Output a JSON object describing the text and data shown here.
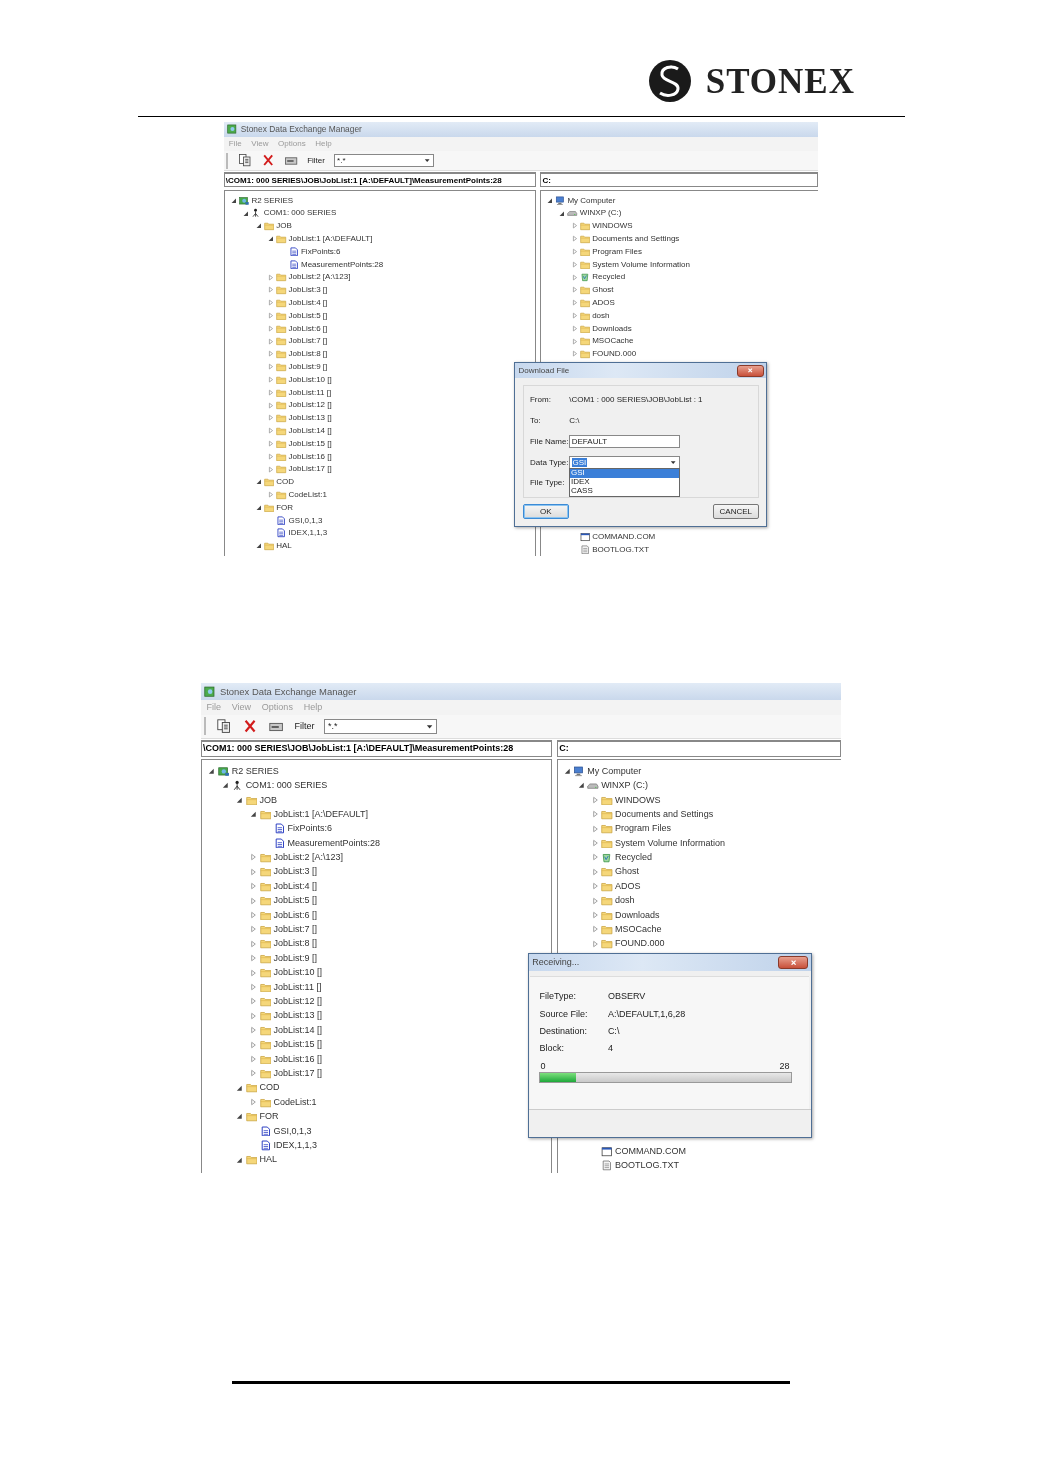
{
  "page": {
    "brand": "STONEX"
  },
  "screenshots": [
    {
      "title": "Stonex Data Exchange Manager",
      "menu": [
        {
          "label": "File"
        },
        {
          "label": "View"
        },
        {
          "label": "Options"
        },
        {
          "label": "Help"
        }
      ],
      "filter_label": "Filter",
      "filter_value": "*.*",
      "path_left": "\\COM1: 000 SERIES\\JOB\\JobList:1 [A:\\DEFAULT]\\MeasurementPoints:28",
      "path_right": "C:",
      "left_tree": [
        {
          "label": "R2 SERIES",
          "kind": "series",
          "expanded": true,
          "children": [
            {
              "label": "COM1: 000 SERIES",
              "kind": "instrument",
              "expanded": true,
              "children": [
                {
                  "label": "JOB",
                  "kind": "folder",
                  "expanded": true,
                  "children": [
                    {
                      "label": "JobList:1 [A:\\DEFAULT]",
                      "kind": "folder",
                      "expanded": true,
                      "children": [
                        {
                          "label": "FixPoints:6",
                          "kind": "doc"
                        },
                        {
                          "label": "MeasurementPoints:28",
                          "kind": "doc"
                        }
                      ]
                    },
                    {
                      "label": "JobList:2 [A:\\123]",
                      "kind": "folder",
                      "expanded": false
                    },
                    {
                      "label": "JobList:3 []",
                      "kind": "folder",
                      "expanded": false
                    },
                    {
                      "label": "JobList:4 []",
                      "kind": "folder",
                      "expanded": false
                    },
                    {
                      "label": "JobList:5 []",
                      "kind": "folder",
                      "expanded": false
                    },
                    {
                      "label": "JobList:6 []",
                      "kind": "folder",
                      "expanded": false
                    },
                    {
                      "label": "JobList:7 []",
                      "kind": "folder",
                      "expanded": false
                    },
                    {
                      "label": "JobList:8 []",
                      "kind": "folder",
                      "expanded": false
                    },
                    {
                      "label": "JobList:9 []",
                      "kind": "folder",
                      "expanded": false
                    },
                    {
                      "label": "JobList:10 []",
                      "kind": "folder",
                      "expanded": false
                    },
                    {
                      "label": "JobList:11 []",
                      "kind": "folder",
                      "expanded": false
                    },
                    {
                      "label": "JobList:12 []",
                      "kind": "folder",
                      "expanded": false
                    },
                    {
                      "label": "JobList:13 []",
                      "kind": "folder",
                      "expanded": false
                    },
                    {
                      "label": "JobList:14 []",
                      "kind": "folder",
                      "expanded": false
                    },
                    {
                      "label": "JobList:15 []",
                      "kind": "folder",
                      "expanded": false
                    },
                    {
                      "label": "JobList:16 []",
                      "kind": "folder",
                      "expanded": false
                    },
                    {
                      "label": "JobList:17 []",
                      "kind": "folder",
                      "expanded": false
                    }
                  ]
                },
                {
                  "label": "COD",
                  "kind": "folder",
                  "expanded": true,
                  "children": [
                    {
                      "label": "CodeList:1",
                      "kind": "folder",
                      "expanded": false
                    }
                  ]
                },
                {
                  "label": "FOR",
                  "kind": "folder",
                  "expanded": true,
                  "children": [
                    {
                      "label": "GSI,0,1,3",
                      "kind": "doc"
                    },
                    {
                      "label": "IDEX,1,1,3",
                      "kind": "doc"
                    }
                  ]
                },
                {
                  "label": "HAL",
                  "kind": "folder",
                  "expanded": true
                }
              ]
            }
          ]
        }
      ],
      "right_tree": [
        {
          "label": "My Computer",
          "kind": "computer",
          "expanded": true,
          "children": [
            {
              "label": "WINXP (C:)",
              "kind": "drive",
              "expanded": true,
              "children": [
                {
                  "label": "WINDOWS",
                  "kind": "folder",
                  "expanded": false
                },
                {
                  "label": "Documents and Settings",
                  "kind": "folder",
                  "expanded": false
                },
                {
                  "label": "Program Files",
                  "kind": "folder",
                  "expanded": false
                },
                {
                  "label": "System Volume Information",
                  "kind": "folder",
                  "expanded": false
                },
                {
                  "label": "Recycled",
                  "kind": "recycle",
                  "expanded": false
                },
                {
                  "label": "Ghost",
                  "kind": "folder",
                  "expanded": false
                },
                {
                  "label": "ADOS",
                  "kind": "folder",
                  "expanded": false
                },
                {
                  "label": "dosh",
                  "kind": "folder",
                  "expanded": false
                },
                {
                  "label": "Downloads",
                  "kind": "folder",
                  "expanded": false
                },
                {
                  "label": "MSOCache",
                  "kind": "folder",
                  "expanded": false
                },
                {
                  "label": "FOUND.000",
                  "kind": "folder",
                  "expanded": false
                },
                {
                  "label": "COMMAND.COM",
                  "kind": "exe"
                },
                {
                  "label": "BOOTLOG.TXT",
                  "kind": "txt"
                }
              ]
            }
          ]
        }
      ],
      "dialog": {
        "kind": "download",
        "title": "Download File",
        "fields": [
          {
            "label": "From:",
            "kind": "text",
            "value": "\\COM1 : 000 SERIES\\JOB\\JobList : 1"
          },
          {
            "label": "To:",
            "kind": "text",
            "value": "C:\\"
          },
          {
            "label": "File Name:",
            "kind": "input",
            "value": "DEFAULT"
          },
          {
            "label": "Data Type:",
            "kind": "select",
            "value": "GSI",
            "options": [
              {
                "label": "GSI",
                "selected": true
              },
              {
                "label": "IDEX",
                "selected": false
              },
              {
                "label": "CASS",
                "selected": false
              }
            ]
          },
          {
            "label": "File Type:",
            "kind": "text"
          }
        ],
        "buttons": [
          {
            "label": "OK",
            "focused": true
          },
          {
            "label": "CANCEL",
            "focused": false
          }
        ]
      }
    },
    {
      "title": "Stonex Data Exchange Manager",
      "menu": [
        {
          "label": "File"
        },
        {
          "label": "View"
        },
        {
          "label": "Options"
        },
        {
          "label": "Help"
        }
      ],
      "filter_label": "Filter",
      "filter_value": "*.*",
      "path_left": "\\COM1: 000 SERIES\\JOB\\JobList:1 [A:\\DEFAULT]\\MeasurementPoints:28",
      "path_right": "C:",
      "left_tree": [
        {
          "label": "R2 SERIES",
          "kind": "series",
          "expanded": true,
          "children": [
            {
              "label": "COM1: 000 SERIES",
              "kind": "instrument",
              "expanded": true,
              "children": [
                {
                  "label": "JOB",
                  "kind": "folder",
                  "expanded": true,
                  "children": [
                    {
                      "label": "JobList:1 [A:\\DEFAULT]",
                      "kind": "folder",
                      "expanded": true,
                      "children": [
                        {
                          "label": "FixPoints:6",
                          "kind": "doc"
                        },
                        {
                          "label": "MeasurementPoints:28",
                          "kind": "doc"
                        }
                      ]
                    },
                    {
                      "label": "JobList:2 [A:\\123]",
                      "kind": "folder",
                      "expanded": false
                    },
                    {
                      "label": "JobList:3 []",
                      "kind": "folder",
                      "expanded": false
                    },
                    {
                      "label": "JobList:4 []",
                      "kind": "folder",
                      "expanded": false
                    },
                    {
                      "label": "JobList:5 []",
                      "kind": "folder",
                      "expanded": false
                    },
                    {
                      "label": "JobList:6 []",
                      "kind": "folder",
                      "expanded": false
                    },
                    {
                      "label": "JobList:7 []",
                      "kind": "folder",
                      "expanded": false
                    },
                    {
                      "label": "JobList:8 []",
                      "kind": "folder",
                      "expanded": false
                    },
                    {
                      "label": "JobList:9 []",
                      "kind": "folder",
                      "expanded": false
                    },
                    {
                      "label": "JobList:10 []",
                      "kind": "folder",
                      "expanded": false
                    },
                    {
                      "label": "JobList:11 []",
                      "kind": "folder",
                      "expanded": false
                    },
                    {
                      "label": "JobList:12 []",
                      "kind": "folder",
                      "expanded": false
                    },
                    {
                      "label": "JobList:13 []",
                      "kind": "folder",
                      "expanded": false
                    },
                    {
                      "label": "JobList:14 []",
                      "kind": "folder",
                      "expanded": false
                    },
                    {
                      "label": "JobList:15 []",
                      "kind": "folder",
                      "expanded": false
                    },
                    {
                      "label": "JobList:16 []",
                      "kind": "folder",
                      "expanded": false
                    },
                    {
                      "label": "JobList:17 []",
                      "kind": "folder",
                      "expanded": false
                    }
                  ]
                },
                {
                  "label": "COD",
                  "kind": "folder",
                  "expanded": true,
                  "children": [
                    {
                      "label": "CodeList:1",
                      "kind": "folder",
                      "expanded": false
                    }
                  ]
                },
                {
                  "label": "FOR",
                  "kind": "folder",
                  "expanded": true,
                  "children": [
                    {
                      "label": "GSI,0,1,3",
                      "kind": "doc"
                    },
                    {
                      "label": "IDEX,1,1,3",
                      "kind": "doc"
                    }
                  ]
                },
                {
                  "label": "HAL",
                  "kind": "folder",
                  "expanded": true
                }
              ]
            }
          ]
        }
      ],
      "right_tree": [
        {
          "label": "My Computer",
          "kind": "computer",
          "expanded": true,
          "children": [
            {
              "label": "WINXP (C:)",
              "kind": "drive",
              "expanded": true,
              "children": [
                {
                  "label": "WINDOWS",
                  "kind": "folder",
                  "expanded": false
                },
                {
                  "label": "Documents and Settings",
                  "kind": "folder",
                  "expanded": false
                },
                {
                  "label": "Program Files",
                  "kind": "folder",
                  "expanded": false
                },
                {
                  "label": "System Volume Information",
                  "kind": "folder",
                  "expanded": false
                },
                {
                  "label": "Recycled",
                  "kind": "recycle",
                  "expanded": false
                },
                {
                  "label": "Ghost",
                  "kind": "folder",
                  "expanded": false
                },
                {
                  "label": "ADOS",
                  "kind": "folder",
                  "expanded": false
                },
                {
                  "label": "dosh",
                  "kind": "folder",
                  "expanded": false
                },
                {
                  "label": "Downloads",
                  "kind": "folder",
                  "expanded": false
                },
                {
                  "label": "MSOCache",
                  "kind": "folder",
                  "expanded": false
                },
                {
                  "label": "FOUND.000",
                  "kind": "folder",
                  "expanded": false
                },
                {
                  "label": "COMMAND.COM",
                  "kind": "exe"
                },
                {
                  "label": "BOOTLOG.TXT",
                  "kind": "txt"
                }
              ]
            }
          ]
        }
      ],
      "dialog": {
        "kind": "progress",
        "title": "Receiving...",
        "fields": [
          {
            "label": "FileType:",
            "kind": "text",
            "value": "OBSERV"
          },
          {
            "label": "Source File:",
            "kind": "text",
            "value": "A:\\DEFAULT,1,6,28"
          },
          {
            "label": "Destination:",
            "kind": "text",
            "value": "C:\\"
          },
          {
            "label": "Block:",
            "kind": "text",
            "value": "4"
          }
        ],
        "progress": {
          "min_label": "0",
          "max_label": "28",
          "level": 0.14
        }
      }
    }
  ]
}
